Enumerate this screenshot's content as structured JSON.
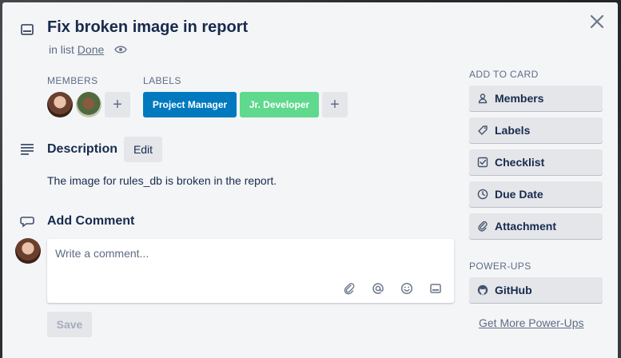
{
  "card": {
    "title": "Fix broken image in report",
    "in_list_prefix": "in list",
    "list_name": "Done"
  },
  "members": {
    "heading": "MEMBERS",
    "add": "+"
  },
  "labels": {
    "heading": "LABELS",
    "items": [
      {
        "text": "Project Manager",
        "color": "#0079bf"
      },
      {
        "text": "Jr. Developer",
        "color": "#5fd98d"
      }
    ],
    "add": "+"
  },
  "description": {
    "heading": "Description",
    "edit_label": "Edit",
    "text": "The image for rules_db is broken in the report."
  },
  "comment": {
    "heading": "Add Comment",
    "placeholder": "Write a comment...",
    "save_label": "Save"
  },
  "sidebar": {
    "add_heading": "ADD TO CARD",
    "add_items": [
      {
        "label": "Members",
        "icon": "person-icon"
      },
      {
        "label": "Labels",
        "icon": "tag-icon"
      },
      {
        "label": "Checklist",
        "icon": "checkbox-icon"
      },
      {
        "label": "Due Date",
        "icon": "clock-icon"
      },
      {
        "label": "Attachment",
        "icon": "paperclip-icon"
      }
    ],
    "powerups_heading": "POWER-UPS",
    "powerups_items": [
      {
        "label": "GitHub",
        "icon": "github-icon"
      }
    ],
    "get_more": "Get More Power-Ups"
  }
}
